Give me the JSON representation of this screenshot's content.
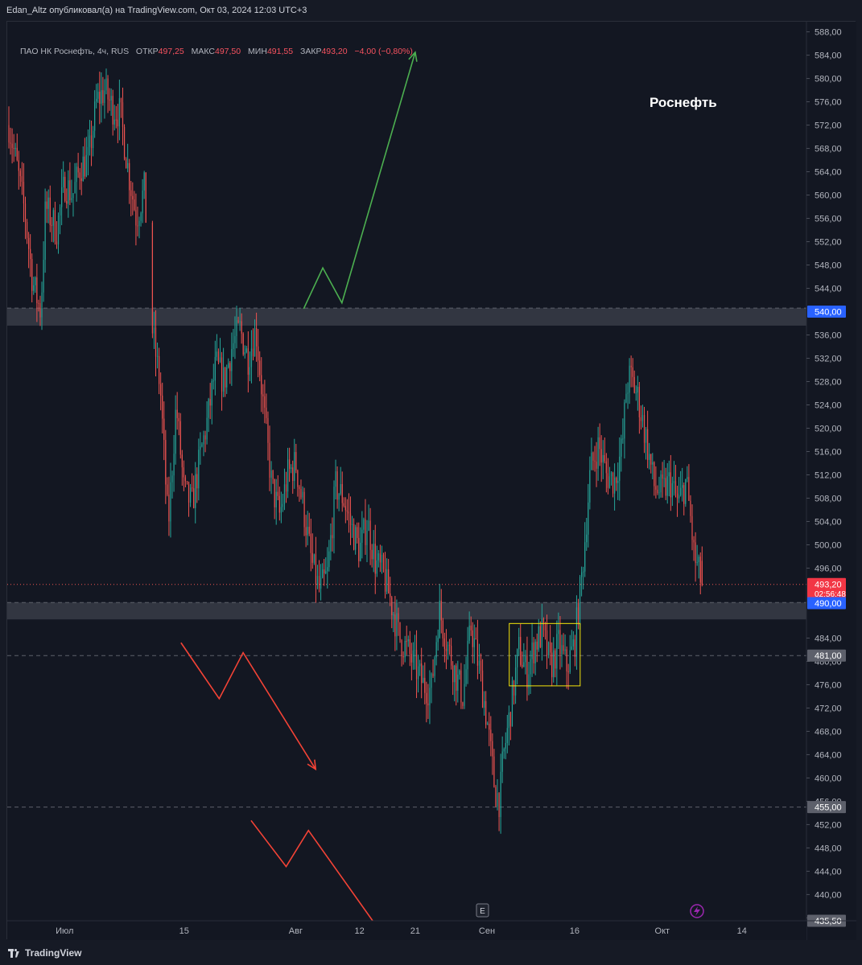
{
  "header": {
    "publisher": "Edan_Altz опубликовал(а) на TradingView.com, Окт 03, 2024 12:03 UTC+3"
  },
  "legend": {
    "symbol": "ПАО НК Роснефть, 4ч, RUS",
    "open_label": "ОТКР",
    "open_value": "497,25",
    "high_label": "МАКС",
    "high_value": "497,50",
    "low_label": "МИН",
    "low_value": "491,55",
    "close_label": "ЗАКР",
    "close_value": "493,20",
    "change": "−4,00 (−0,80%)"
  },
  "footer": {
    "brand": "TradingView"
  },
  "colors": {
    "background": "#131722",
    "up": "#26a69a",
    "down": "#ef5350",
    "zone": "#363a45",
    "green_arrow": "#4caf50",
    "red_arrow": "#f44336",
    "box": "#f5e50a"
  },
  "chart_data": {
    "type": "candlestick",
    "title": "Роснефть",
    "y_axis": {
      "range": [
        435.5,
        589.6
      ],
      "ticks": [
        "588,00",
        "584,00",
        "580,00",
        "576,00",
        "572,00",
        "568,00",
        "564,00",
        "560,00",
        "556,00",
        "552,00",
        "548,00",
        "544,00",
        "536,00",
        "532,00",
        "528,00",
        "524,00",
        "520,00",
        "516,00",
        "512,00",
        "508,00",
        "504,00",
        "500,00",
        "496,00",
        "484,00",
        "480,00",
        "476,00",
        "472,00",
        "468,00",
        "464,00",
        "460,00",
        "456,00",
        "452,00",
        "448,00",
        "444,00",
        "440,00",
        "436,00"
      ],
      "tick_values": [
        588,
        584,
        580,
        576,
        572,
        568,
        564,
        560,
        556,
        552,
        548,
        544,
        536,
        532,
        528,
        524,
        520,
        516,
        512,
        508,
        504,
        500,
        496,
        484,
        480,
        476,
        472,
        468,
        464,
        460,
        456,
        452,
        448,
        444,
        440,
        436
      ]
    },
    "x_axis": {
      "labels": [
        "Июл",
        "15",
        "Авг",
        "12",
        "21",
        "Сен",
        "16",
        "Окт",
        "14"
      ],
      "positions": [
        7,
        22,
        36,
        44,
        51,
        60,
        71,
        82,
        92
      ]
    },
    "price_labels": [
      {
        "value": 540.0,
        "text": "540,00",
        "style": "zone"
      },
      {
        "value": 493.2,
        "text": "493,20",
        "style": "last",
        "countdown": "02:56:48"
      },
      {
        "value": 490.0,
        "text": "490,00",
        "style": "zone"
      },
      {
        "value": 481.0,
        "text": "481,00",
        "style": "line"
      },
      {
        "value": 455.0,
        "text": "455,00",
        "style": "line"
      },
      {
        "value": 435.5,
        "text": "435,50",
        "style": "line"
      }
    ],
    "zones": [
      {
        "from": 537.6,
        "to": 540.6
      },
      {
        "from": 487.2,
        "to": 490.1
      }
    ],
    "hlines": [
      481.0,
      455.0,
      435.5
    ],
    "last_price": 493.2,
    "box": {
      "x_from": 62.8,
      "x_to": 71.7,
      "y_from": 475.8,
      "y_to": 486.5
    },
    "arrows": [
      {
        "color": "green",
        "points": [
          [
            37,
            540.5
          ],
          [
            39.4,
            547.5
          ],
          [
            41.8,
            541.5
          ],
          [
            51,
            584.5
          ]
        ]
      },
      {
        "color": "red",
        "points": [
          [
            21.6,
            483.2
          ],
          [
            26.4,
            473.6
          ],
          [
            29.4,
            481.5
          ],
          [
            38.5,
            461.5
          ]
        ]
      },
      {
        "color": "red",
        "points": [
          [
            30.4,
            452.7
          ],
          [
            34.8,
            444.8
          ],
          [
            37.6,
            451.0
          ],
          [
            46.7,
            433.5
          ]
        ]
      }
    ],
    "waypoints": [
      [
        0,
        572
      ],
      [
        1,
        565
      ],
      [
        2,
        557
      ],
      [
        3,
        545
      ],
      [
        4,
        540
      ],
      [
        4.6,
        558
      ],
      [
        6,
        554
      ],
      [
        7,
        562
      ],
      [
        8,
        560
      ],
      [
        9,
        565
      ],
      [
        10,
        566
      ],
      [
        11,
        576
      ],
      [
        12,
        578
      ],
      [
        13,
        575
      ],
      [
        14,
        574
      ],
      [
        15,
        564
      ],
      [
        16,
        556
      ],
      [
        17,
        561
      ],
      [
        18,
        537
      ],
      [
        19,
        527
      ],
      [
        20,
        503
      ],
      [
        21,
        524
      ],
      [
        22,
        509
      ],
      [
        23,
        507
      ],
      [
        24,
        515
      ],
      [
        25,
        522
      ],
      [
        26,
        531
      ],
      [
        27,
        528
      ],
      [
        28,
        534
      ],
      [
        29,
        537
      ],
      [
        30,
        532
      ],
      [
        31,
        537
      ],
      [
        32,
        523
      ],
      [
        33,
        510
      ],
      [
        34,
        505
      ],
      [
        35,
        512
      ],
      [
        36,
        514
      ],
      [
        37,
        506
      ],
      [
        38,
        497
      ],
      [
        39,
        492
      ],
      [
        40,
        495
      ],
      [
        41,
        510
      ],
      [
        42,
        508
      ],
      [
        43,
        503
      ],
      [
        44,
        499
      ],
      [
        45,
        504
      ],
      [
        46,
        497
      ],
      [
        47,
        495
      ],
      [
        48,
        490
      ],
      [
        49,
        484
      ],
      [
        50,
        482
      ],
      [
        51,
        479
      ],
      [
        52,
        476
      ],
      [
        53,
        475
      ],
      [
        54,
        489
      ],
      [
        55,
        483
      ],
      [
        56,
        478
      ],
      [
        57,
        474
      ],
      [
        58,
        486
      ],
      [
        59,
        479
      ],
      [
        60,
        470
      ],
      [
        61,
        458
      ],
      [
        61.6,
        456
      ],
      [
        62,
        463
      ],
      [
        63,
        472
      ],
      [
        64,
        482
      ],
      [
        65,
        478
      ],
      [
        66,
        483
      ],
      [
        67,
        485
      ],
      [
        68,
        479
      ],
      [
        69,
        483
      ],
      [
        70,
        479
      ],
      [
        71,
        483
      ],
      [
        72,
        496
      ],
      [
        73,
        513
      ],
      [
        74,
        517
      ],
      [
        75,
        512
      ],
      [
        76,
        511
      ],
      [
        77,
        517
      ],
      [
        77.5,
        527
      ],
      [
        78,
        529
      ],
      [
        79,
        525
      ],
      [
        80,
        518
      ],
      [
        81,
        510
      ],
      [
        82,
        509
      ],
      [
        83,
        511
      ],
      [
        84,
        507
      ],
      [
        85,
        511
      ],
      [
        85.6,
        504
      ],
      [
        86,
        498
      ],
      [
        87,
        493.2
      ]
    ]
  }
}
